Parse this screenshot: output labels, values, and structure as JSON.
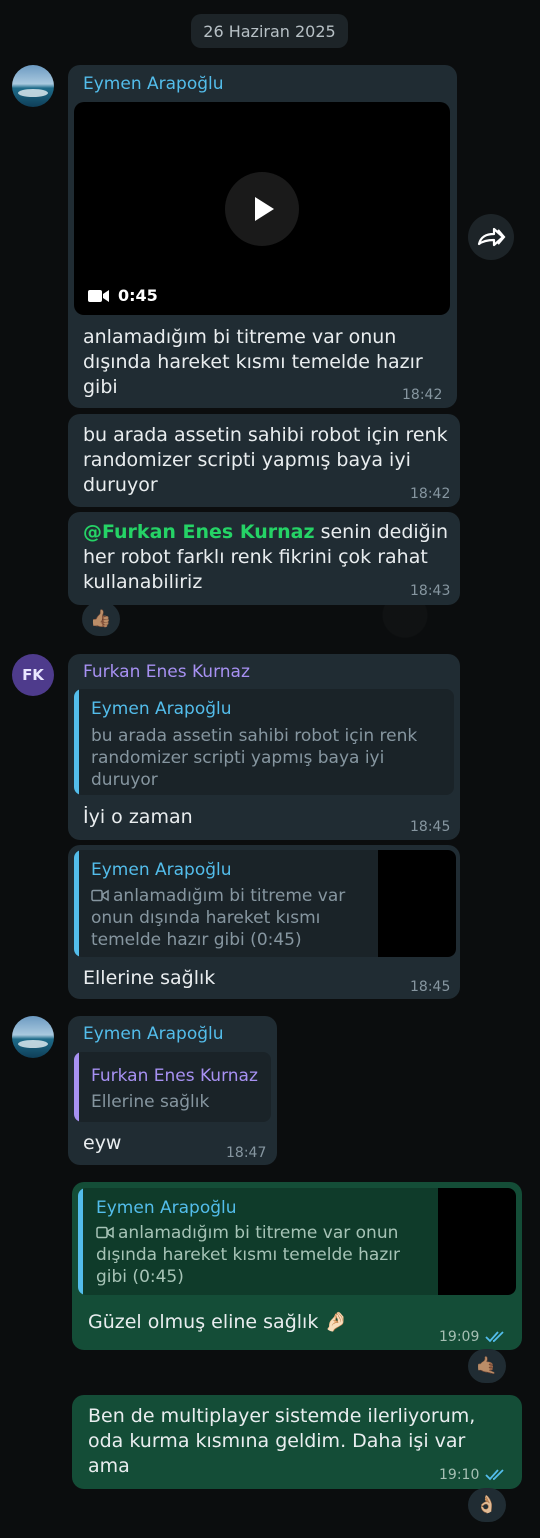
{
  "date_label": "26 Haziran 2025",
  "messages": {
    "m1": {
      "sender": "Eymen Arapoğlu",
      "video_duration": "0:45",
      "lines": [
        "anlamadığım bi titreme var onun",
        "dışında hareket kısmı temelde hazır",
        "gibi"
      ],
      "time": "18:42"
    },
    "m2": {
      "lines": [
        "bu arada assetin sahibi robot için renk",
        "randomizer scripti yapmış baya iyi",
        "duruyor"
      ],
      "time": "18:42"
    },
    "m3": {
      "mention": "@Furkan Enes Kurnaz",
      "line1_rest": " senin dediğin",
      "lines": [
        "her robot farklı renk fikrini çok rahat",
        "kullanabiliriz"
      ],
      "time": "18:43",
      "reaction": "👍🏽"
    },
    "m4": {
      "avatar_initials": "FK",
      "sender": "Furkan Enes Kurnaz",
      "quote_name": "Eymen Arapoğlu",
      "quote_lines": [
        "bu arada assetin sahibi robot için renk",
        "randomizer scripti yapmış baya iyi",
        "duruyor"
      ],
      "text": "İyi o zaman",
      "time": "18:45"
    },
    "m5": {
      "quote_name": "Eymen Arapoğlu",
      "quote_lines": [
        "anlamadığım bi titreme var",
        "onun dışında hareket kısmı",
        "temelde hazır gibi (0:45)"
      ],
      "text": "Ellerine sağlık",
      "time": "18:45"
    },
    "m6": {
      "sender": "Eymen Arapoğlu",
      "quote_name": "Furkan Enes Kurnaz",
      "quote_text": "Ellerine sağlık",
      "text": "eyw",
      "time": "18:47"
    },
    "m7": {
      "quote_name": "Eymen Arapoğlu",
      "quote_lines": [
        "anlamadığım bi titreme var onun",
        "dışında hareket kısmı temelde hazır",
        "gibi (0:45)"
      ],
      "text": "Güzel olmuş eline sağlık 🤌🏻",
      "time": "19:09",
      "reaction": "🤙🏽"
    },
    "m8": {
      "lines": [
        "Ben de multiplayer sistemde ilerliyorum,",
        "oda kurma kısmına geldim. Daha işi var",
        "ama"
      ],
      "time": "19:10",
      "reaction": "👌🏼"
    }
  },
  "colors": {
    "incoming_bubble": "#202c33",
    "outgoing_bubble": "#144d37",
    "sender_blue": "#53bdeb",
    "sender_purple": "#a791f2",
    "mention_green": "#25d366",
    "read_ticks": "#53bdeb"
  },
  "icons": [
    "play-icon",
    "video-camera-icon",
    "forward-icon",
    "double-check-icon"
  ]
}
